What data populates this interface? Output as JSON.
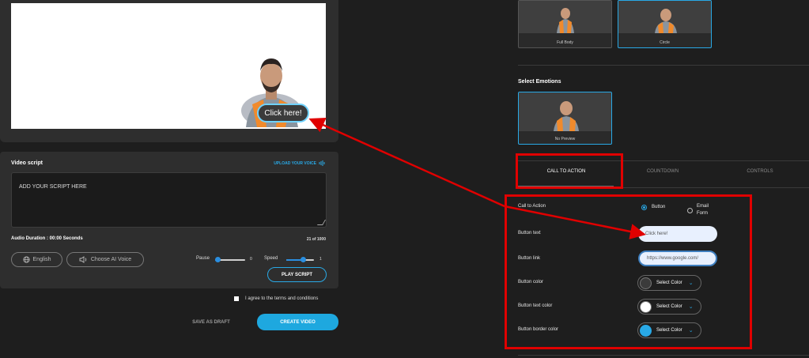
{
  "preview": {
    "cta_label": "Click here!"
  },
  "script_panel": {
    "title": "Video script",
    "upload_voice": "UPLOAD YOUR VOICE",
    "script_text": "ADD YOUR  SCRIPT HERE",
    "audio_duration": "Audio Duration : 00:00 Seconds",
    "char_count": "21 of 1000",
    "language_label": "English",
    "choose_voice_label": "Choose AI Voice",
    "pause_label": "Pause",
    "pause_value": "0",
    "speed_label": "Speed",
    "speed_value": "1",
    "play_script_label": "PLAY SCRIPT"
  },
  "footer": {
    "terms_label": "I agree to the terms and conditions",
    "save_draft_label": "SAVE AS DRAFT",
    "create_video_label": "CREATE VIDEO"
  },
  "avatar_styles": {
    "items": [
      {
        "label": "Full Body"
      },
      {
        "label": "Circle"
      }
    ]
  },
  "emotions": {
    "title": "Select Emotions",
    "items": [
      {
        "label": "No Preview"
      }
    ]
  },
  "tabs": [
    {
      "label": "CALL TO ACTION"
    },
    {
      "label": "COUNTDOWN"
    },
    {
      "label": "CONTROLS"
    }
  ],
  "cta_form": {
    "call_to_action_label": "Call to Action",
    "option_button": "Button",
    "option_email": "Email Form",
    "button_text_label": "Button text",
    "button_text_value": "Click here!",
    "button_link_label": "Button link",
    "button_link_value": "https://www.google.com/",
    "button_color_label": "Button color",
    "button_text_color_label": "Button text color",
    "button_border_color_label": "Button border color",
    "select_color": "Select Color",
    "colors": {
      "button_color": "#3b3b3b",
      "button_text_color": "#ffffff",
      "button_border_color": "#29a9e6"
    }
  },
  "controls": {
    "pause_level": 0,
    "speed_level": 1
  }
}
